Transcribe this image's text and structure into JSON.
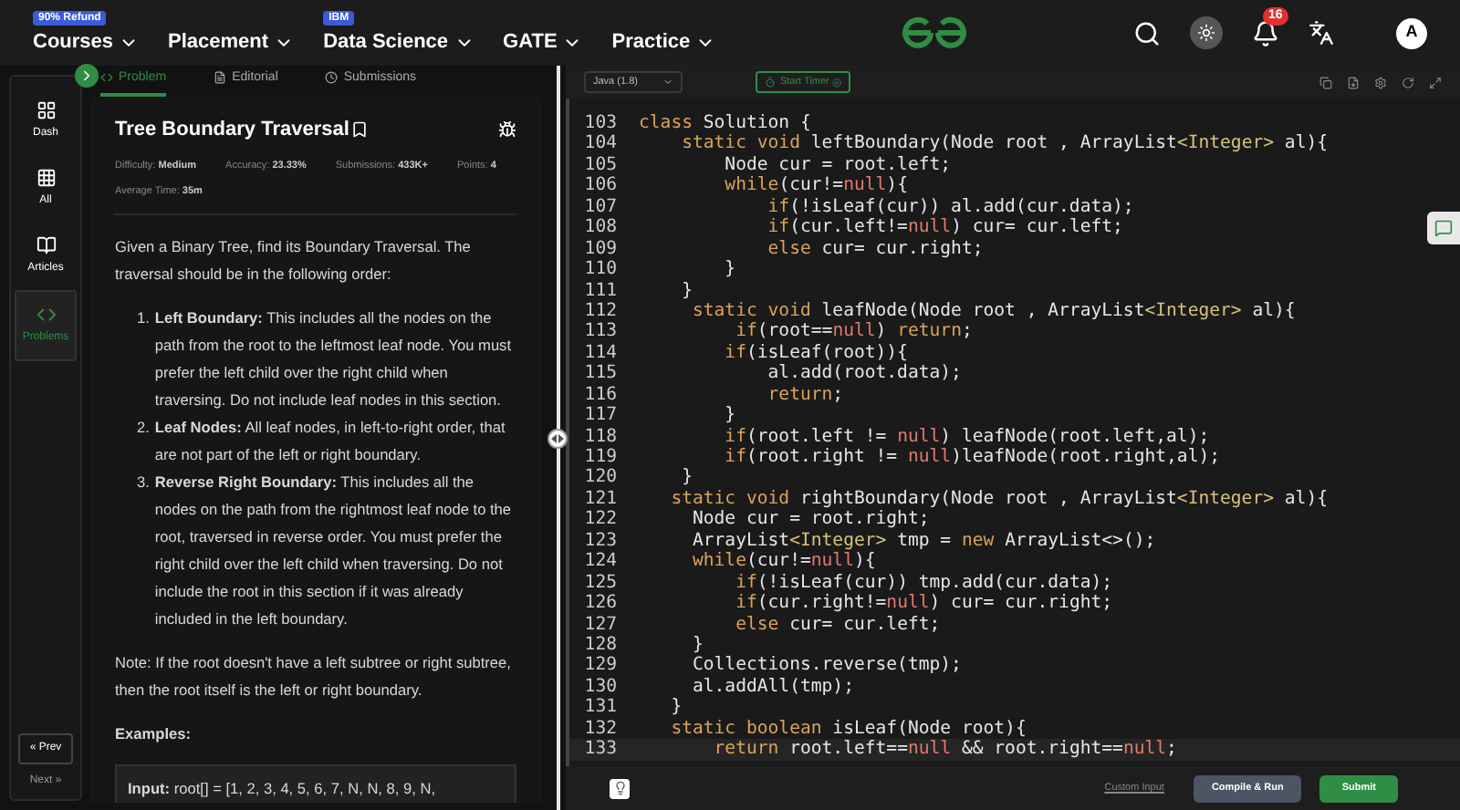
{
  "nav": {
    "items": [
      {
        "label": "Courses",
        "badge": "90% Refund"
      },
      {
        "label": "Placement"
      },
      {
        "label": "Data Science",
        "badge": "IBM"
      },
      {
        "label": "GATE"
      },
      {
        "label": "Practice"
      }
    ],
    "notifications": "16",
    "avatar": "A"
  },
  "sidebar": {
    "items": [
      {
        "label": "Dash",
        "kind": "dash",
        "selected": false
      },
      {
        "label": "All",
        "kind": "all",
        "selected": false
      },
      {
        "label": "Articles",
        "kind": "articles",
        "selected": false
      },
      {
        "label": "Problems",
        "kind": "problems",
        "selected": true
      }
    ],
    "prev": "« Prev",
    "next": "Next »"
  },
  "problem_tabs": [
    {
      "label": "Problem",
      "kind": "problem",
      "selected": true
    },
    {
      "label": "Editorial",
      "kind": "editorial",
      "selected": false
    },
    {
      "label": "Submissions",
      "kind": "submissions",
      "selected": false
    }
  ],
  "problem": {
    "title": "Tree Boundary Traversal",
    "meta": [
      {
        "label": "Difficulty:",
        "value": "Medium"
      },
      {
        "label": "Accuracy:",
        "value": "23.33%"
      },
      {
        "label": "Submissions:",
        "value": "433K+"
      },
      {
        "label": "Points:",
        "value": "4"
      },
      {
        "label": "Average Time:",
        "value": "35m"
      }
    ],
    "intro": "Given a Binary Tree, find its Boundary Traversal. The traversal should be in the following order:",
    "steps": [
      {
        "number": "1.",
        "text": "**Left Boundary:** This includes all the nodes on the path from the root to the leftmost leaf node. You must prefer the left child over the right child when traversing. Do not include leaf nodes in this section."
      },
      {
        "number": "2.",
        "text": "**Leaf Nodes:** All leaf nodes, in left-to-right order, that are not part of the left or right boundary."
      },
      {
        "number": "3.",
        "text": "**Reverse Right Boundary:** This includes all the nodes on the path from the rightmost leaf node to the root, traversed in reverse order. You must prefer the right child over the left child when traversing. Do not include the root in this section if it was already included in the left boundary."
      }
    ],
    "note": "Note: If the root doesn't have a left subtree or right subtree, then the root itself is the left or right boundary.",
    "examples_heading": "Examples:",
    "example_input": "**Input:** root[] = [1, 2, 3, 4, 5, 6, 7, N, N, 8, 9, N,"
  },
  "editor": {
    "language": "Java (1.8)",
    "timer": "Start Timer",
    "lines": [
      {
        "number": "103",
        "tokens": [
          {
            "kind": "keyword",
            "text": "class"
          },
          {
            "kind": "plain",
            "text": " Solution {"
          }
        ]
      },
      {
        "number": "104",
        "tokens": [
          {
            "kind": "keyword",
            "text": "    static void"
          },
          {
            "kind": "plain",
            "text": " leftBoundary(Node root , ArrayList"
          },
          {
            "kind": "type",
            "text": "<Integer>"
          },
          {
            "kind": "plain",
            "text": " al){"
          }
        ]
      },
      {
        "number": "105",
        "tokens": [
          {
            "kind": "plain",
            "text": "        Node cur = root.left;"
          }
        ]
      },
      {
        "number": "106",
        "tokens": [
          {
            "kind": "keyword",
            "text": "        while"
          },
          {
            "kind": "plain",
            "text": "(cur!="
          },
          {
            "kind": "null",
            "text": "null"
          },
          {
            "kind": "plain",
            "text": "){"
          }
        ]
      },
      {
        "number": "107",
        "tokens": [
          {
            "kind": "keyword",
            "text": "            if"
          },
          {
            "kind": "plain",
            "text": "(!isLeaf(cur)) al.add(cur.data);"
          }
        ]
      },
      {
        "number": "108",
        "tokens": [
          {
            "kind": "keyword",
            "text": "            if"
          },
          {
            "kind": "plain",
            "text": "(cur.left!="
          },
          {
            "kind": "null",
            "text": "null"
          },
          {
            "kind": "plain",
            "text": ") cur= cur.left;"
          }
        ]
      },
      {
        "number": "109",
        "tokens": [
          {
            "kind": "keyword",
            "text": "            else"
          },
          {
            "kind": "plain",
            "text": " cur= cur.right;"
          }
        ]
      },
      {
        "number": "110",
        "tokens": [
          {
            "kind": "plain",
            "text": "        }"
          }
        ]
      },
      {
        "number": "111",
        "tokens": [
          {
            "kind": "plain",
            "text": "    }"
          }
        ]
      },
      {
        "number": "112",
        "tokens": [
          {
            "kind": "keyword",
            "text": "     static void"
          },
          {
            "kind": "plain",
            "text": " leafNode(Node root , ArrayList"
          },
          {
            "kind": "type",
            "text": "<Integer>"
          },
          {
            "kind": "plain",
            "text": " al){"
          }
        ]
      },
      {
        "number": "113",
        "tokens": [
          {
            "kind": "keyword",
            "text": "         if"
          },
          {
            "kind": "plain",
            "text": "(root=="
          },
          {
            "kind": "null",
            "text": "null"
          },
          {
            "kind": "plain",
            "text": ") "
          },
          {
            "kind": "keyword",
            "text": "return"
          },
          {
            "kind": "plain",
            "text": ";"
          }
        ]
      },
      {
        "number": "114",
        "tokens": [
          {
            "kind": "keyword",
            "text": "        if"
          },
          {
            "kind": "plain",
            "text": "(isLeaf(root)){"
          }
        ]
      },
      {
        "number": "115",
        "tokens": [
          {
            "kind": "plain",
            "text": "            al.add(root.data);"
          }
        ]
      },
      {
        "number": "116",
        "tokens": [
          {
            "kind": "keyword",
            "text": "            return"
          },
          {
            "kind": "plain",
            "text": ";"
          }
        ]
      },
      {
        "number": "117",
        "tokens": [
          {
            "kind": "plain",
            "text": "        }"
          }
        ]
      },
      {
        "number": "118",
        "tokens": [
          {
            "kind": "keyword",
            "text": "        if"
          },
          {
            "kind": "plain",
            "text": "(root.left != "
          },
          {
            "kind": "null",
            "text": "null"
          },
          {
            "kind": "plain",
            "text": ") leafNode(root.left,al);"
          }
        ]
      },
      {
        "number": "119",
        "tokens": [
          {
            "kind": "keyword",
            "text": "        if"
          },
          {
            "kind": "plain",
            "text": "(root.right != "
          },
          {
            "kind": "null",
            "text": "null"
          },
          {
            "kind": "plain",
            "text": ")leafNode(root.right,al);"
          }
        ]
      },
      {
        "number": "120",
        "tokens": [
          {
            "kind": "plain",
            "text": "    }"
          }
        ]
      },
      {
        "number": "121",
        "tokens": [
          {
            "kind": "keyword",
            "text": "   static void"
          },
          {
            "kind": "plain",
            "text": " rightBoundary(Node root , ArrayList"
          },
          {
            "kind": "type",
            "text": "<Integer>"
          },
          {
            "kind": "plain",
            "text": " al){"
          }
        ]
      },
      {
        "number": "122",
        "tokens": [
          {
            "kind": "plain",
            "text": "     Node cur = root.right;"
          }
        ]
      },
      {
        "number": "123",
        "tokens": [
          {
            "kind": "plain",
            "text": "     ArrayList"
          },
          {
            "kind": "type",
            "text": "<Integer>"
          },
          {
            "kind": "plain",
            "text": " tmp = "
          },
          {
            "kind": "keyword",
            "text": "new"
          },
          {
            "kind": "plain",
            "text": " ArrayList<>();"
          }
        ]
      },
      {
        "number": "124",
        "tokens": [
          {
            "kind": "keyword",
            "text": "     while"
          },
          {
            "kind": "plain",
            "text": "(cur!="
          },
          {
            "kind": "null",
            "text": "null"
          },
          {
            "kind": "plain",
            "text": "){"
          }
        ]
      },
      {
        "number": "125",
        "tokens": [
          {
            "kind": "keyword",
            "text": "         if"
          },
          {
            "kind": "plain",
            "text": "(!isLeaf(cur)) tmp.add(cur.data);"
          }
        ]
      },
      {
        "number": "126",
        "tokens": [
          {
            "kind": "keyword",
            "text": "         if"
          },
          {
            "kind": "plain",
            "text": "(cur.right!="
          },
          {
            "kind": "null",
            "text": "null"
          },
          {
            "kind": "plain",
            "text": ") cur= cur.right;"
          }
        ]
      },
      {
        "number": "127",
        "tokens": [
          {
            "kind": "keyword",
            "text": "         else"
          },
          {
            "kind": "plain",
            "text": " cur= cur.left;"
          }
        ]
      },
      {
        "number": "128",
        "tokens": [
          {
            "kind": "plain",
            "text": "     }"
          }
        ]
      },
      {
        "number": "129",
        "tokens": [
          {
            "kind": "plain",
            "text": "     Collections.reverse(tmp);"
          }
        ]
      },
      {
        "number": "130",
        "tokens": [
          {
            "kind": "plain",
            "text": "     al.addAll(tmp);"
          }
        ]
      },
      {
        "number": "131",
        "tokens": [
          {
            "kind": "plain",
            "text": "   }"
          }
        ]
      },
      {
        "number": "132",
        "tokens": [
          {
            "kind": "keyword",
            "text": "   static boolean"
          },
          {
            "kind": "plain",
            "text": " isLeaf(Node root){"
          }
        ]
      },
      {
        "number": "133",
        "tokens": [
          {
            "kind": "keyword",
            "text": "       return"
          },
          {
            "kind": "plain",
            "text": " root.left=="
          },
          {
            "kind": "null",
            "text": "null"
          },
          {
            "kind": "plain",
            "text": " && root.right=="
          },
          {
            "kind": "null",
            "text": "null"
          },
          {
            "kind": "plain",
            "text": ";"
          }
        ]
      }
    ],
    "custom_input": "Custom Input",
    "run": "Compile & Run",
    "submit": "Submit"
  }
}
